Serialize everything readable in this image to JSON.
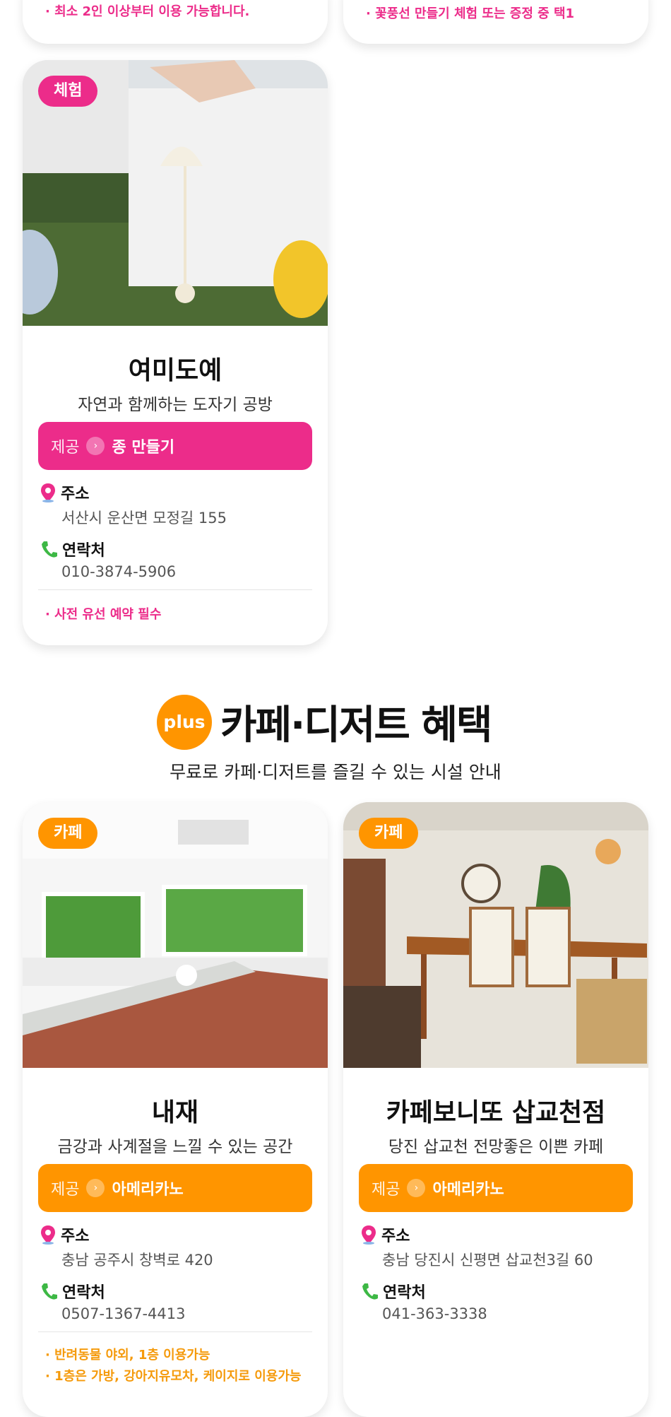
{
  "top_notes": {
    "left": "· 최소 2인 이상부터 이용 가능합니다.",
    "right": "· 꽃풍선 만들기 체험 또는 증정 중 택1"
  },
  "experience_card": {
    "badge": "체험",
    "title": "여미도예",
    "subtitle": "자연과 함께하는 도자기 공방",
    "offer_label": "제공",
    "offer_value": "종 만들기",
    "address_label": "주소",
    "address": "서산시 운산면 모정길 155",
    "contact_label": "연락처",
    "contact": "010-3874-5906",
    "note": "· 사전 유선 예약 필수"
  },
  "section": {
    "plus": "plus",
    "heading": "카페·디저트 혜택",
    "subheading": "무료로 카페·디저트를 즐길 수 있는 시설 안내"
  },
  "cafe_cards": [
    {
      "badge": "카페",
      "title": "내재",
      "subtitle": "금강과 사계절을 느낄 수 있는 공간",
      "offer_label": "제공",
      "offer_value": "아메리카노",
      "address_label": "주소",
      "address": "충남 공주시 창벽로 420",
      "contact_label": "연락처",
      "contact": "0507-1367-4413",
      "notes": [
        "· 반려동물 야외, 1층 이용가능",
        "· 1층은 가방, 강아지유모차, 케이지로 이용가능"
      ]
    },
    {
      "badge": "카페",
      "title": "카페보니또 삽교천점",
      "subtitle": "당진 삽교천 전망좋은 이쁜 카페",
      "offer_label": "제공",
      "offer_value": "아메리카노",
      "address_label": "주소",
      "address": "충남 당진시 신평면 삽교천3길 60",
      "contact_label": "연락처",
      "contact": "041-363-3338"
    }
  ],
  "colors": {
    "pink": "#ec2c8a",
    "orange": "#ff9500"
  }
}
